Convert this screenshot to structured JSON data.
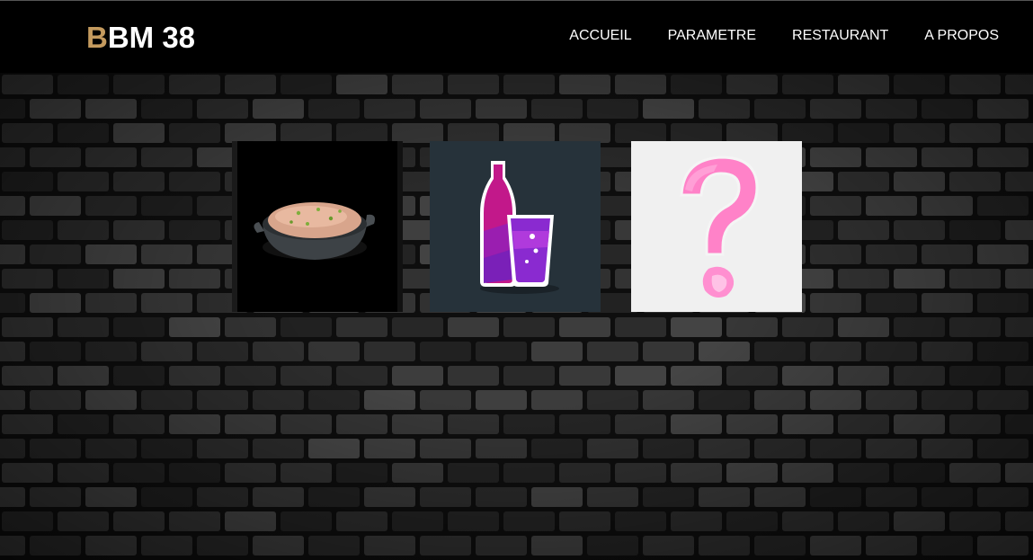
{
  "header": {
    "logo_accent": "B",
    "logo_rest": "BM 38",
    "accent_color": "#c49a5e"
  },
  "nav": {
    "items": [
      {
        "label": "ACCUEIL"
      },
      {
        "label": "PARAMETRE"
      },
      {
        "label": "RESTAURANT"
      },
      {
        "label": "A PROPOS"
      }
    ]
  },
  "tiles": [
    {
      "icon": "food-dish-icon"
    },
    {
      "icon": "soda-bottle-glass-icon"
    },
    {
      "icon": "question-mark-icon"
    }
  ],
  "colors": {
    "navbar": "#000000",
    "wall": "#2a2a2a",
    "pink": "#ff7fc8",
    "drink_tile": "#26323a"
  }
}
